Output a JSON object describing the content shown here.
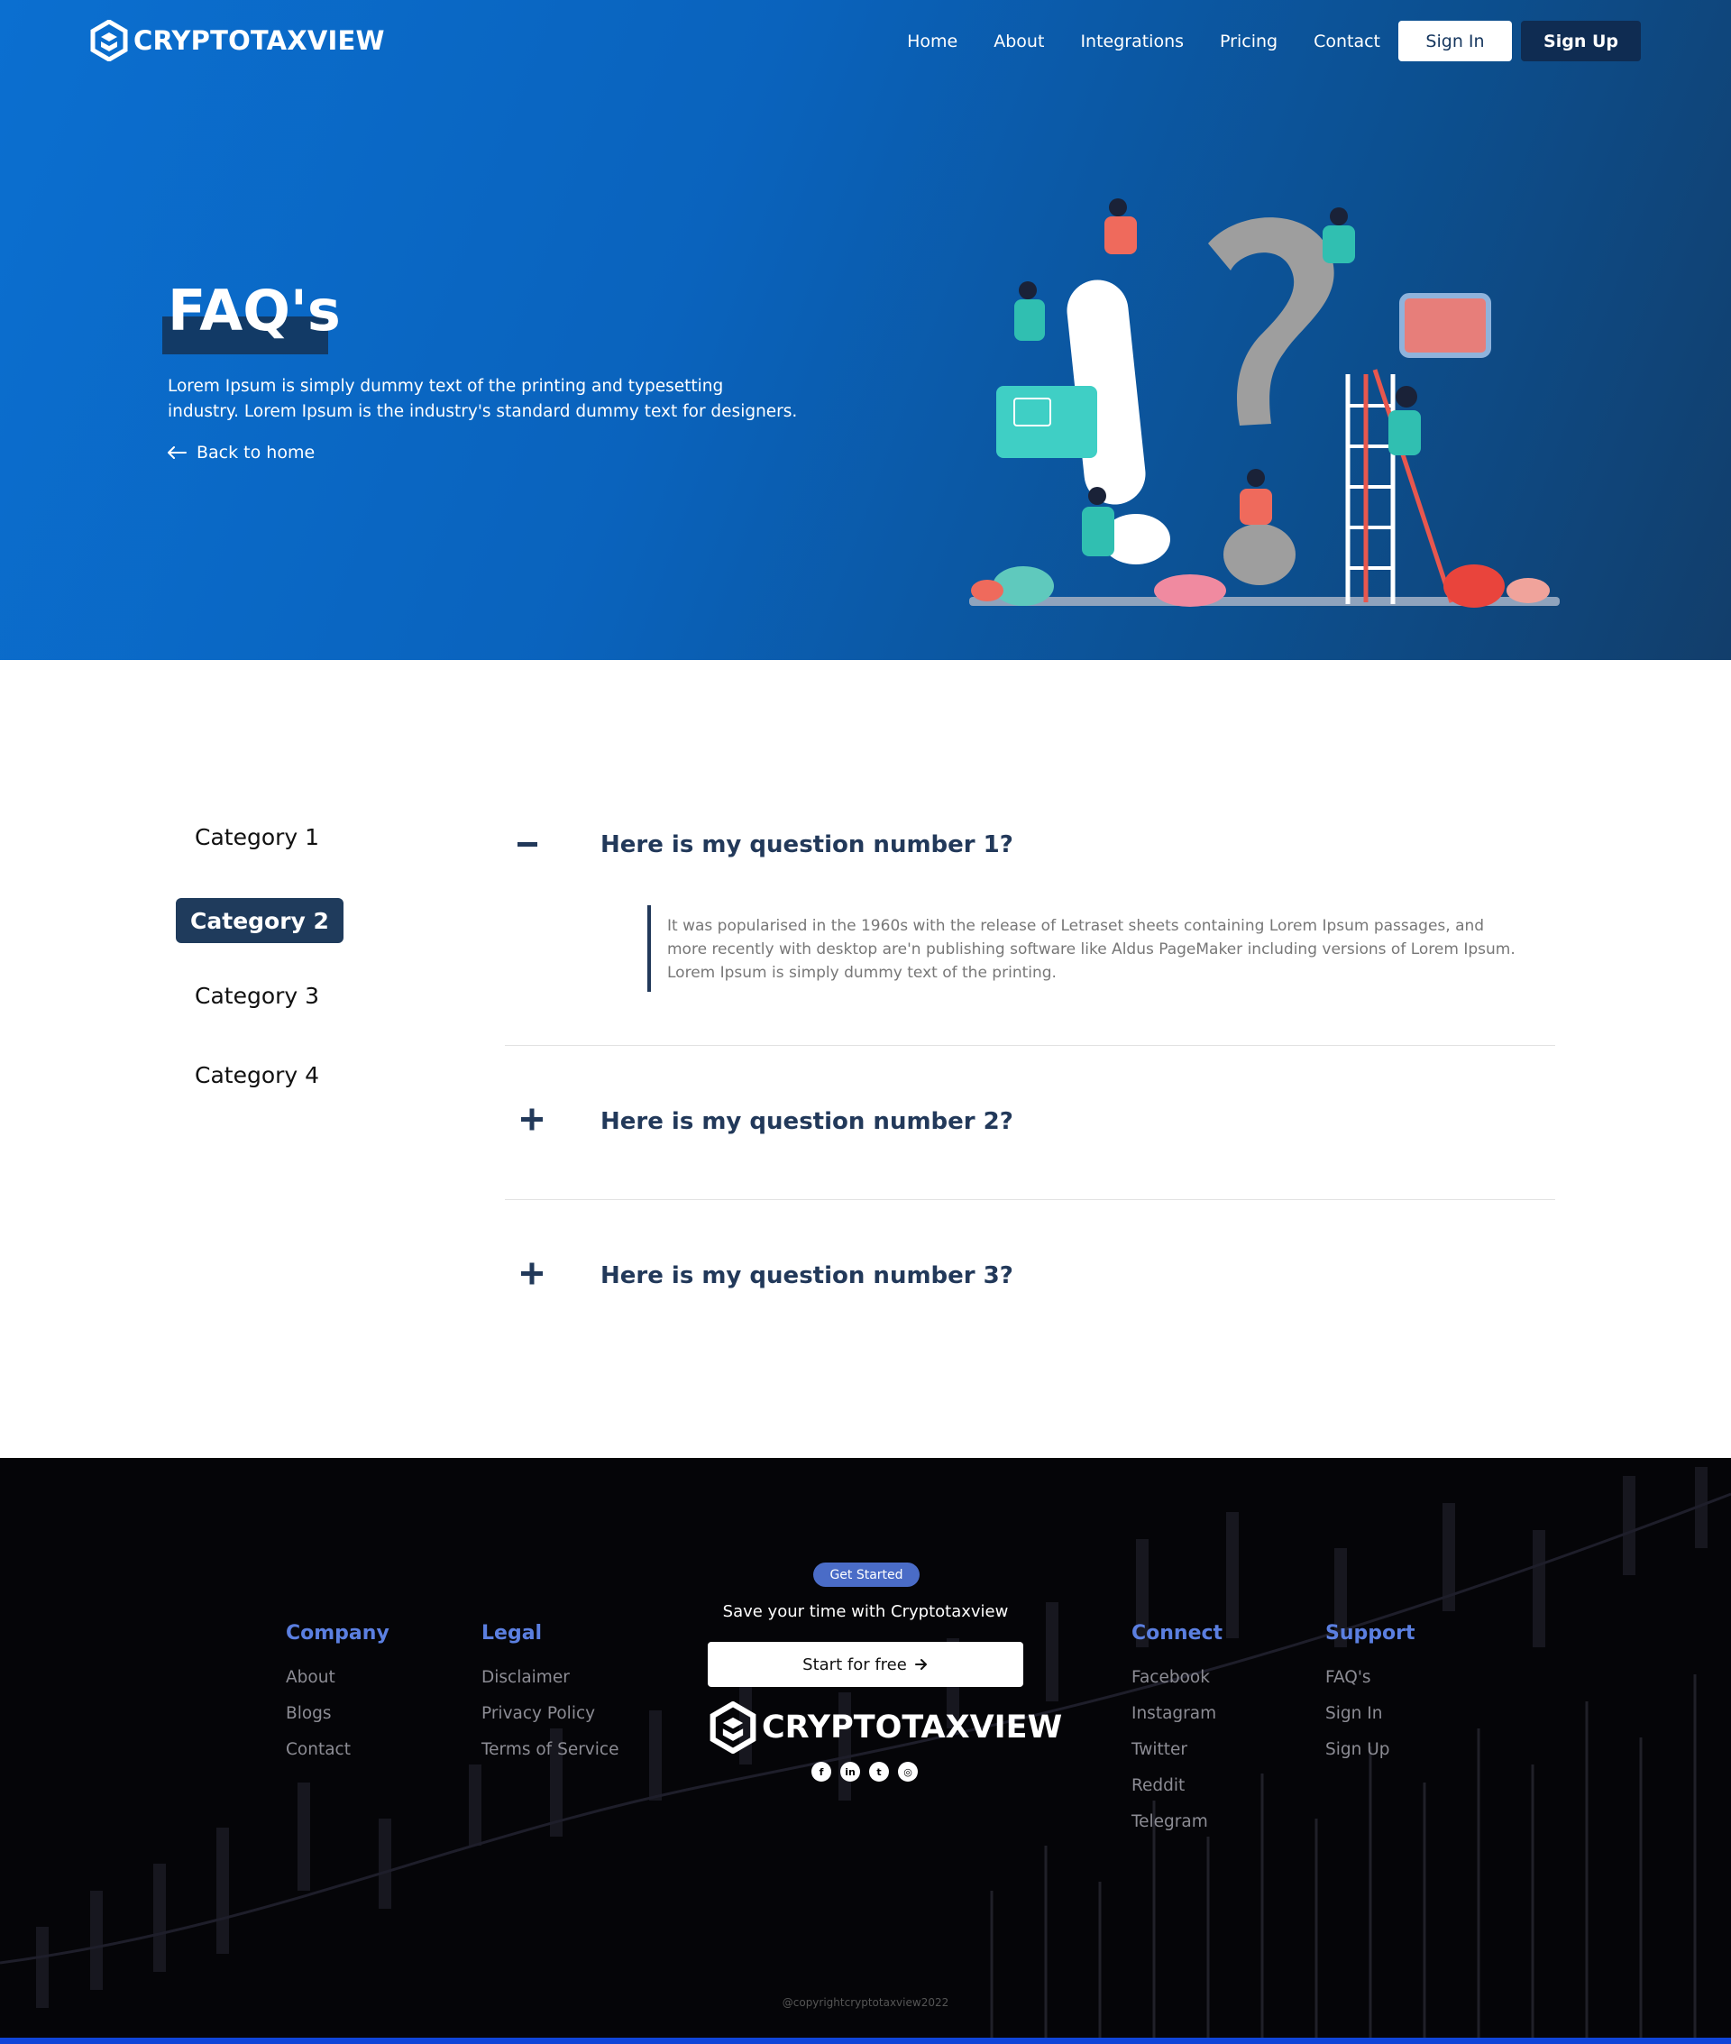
{
  "brand": {
    "name": "CRYPTOTAXVIEW"
  },
  "nav": {
    "links": [
      "Home",
      "About",
      "Integrations",
      "Pricing",
      "Contact"
    ],
    "sign_in": "Sign In",
    "sign_up": "Sign Up"
  },
  "hero": {
    "title": "FAQ's",
    "description": "Lorem Ipsum is simply dummy text of the printing and typesetting industry. Lorem Ipsum is the industry's standard dummy text for designers.",
    "back_link": "Back to home"
  },
  "faq": {
    "categories": [
      "Category 1",
      "Category 2",
      "Category 3",
      "Category 4"
    ],
    "active_category": "Category 2",
    "questions": [
      {
        "title": "Here is my question number 1?",
        "expanded": true,
        "icon": "minus-icon",
        "answer": "It was popularised in the 1960s with the release of Letraset sheets containing Lorem Ipsum passages, and more recently with desktop are'n publishing software like Aldus PageMaker including versions of Lorem Ipsum. Lorem Ipsum is simply dummy text of the printing."
      },
      {
        "title": "Here is my question number 2?",
        "expanded": false,
        "icon": "plus-icon"
      },
      {
        "title": "Here is my question number 3?",
        "expanded": false,
        "icon": "plus-icon"
      }
    ]
  },
  "footer": {
    "company": {
      "heading": "Company",
      "links": [
        "About",
        "Blogs",
        "Contact"
      ]
    },
    "legal": {
      "heading": "Legal",
      "links": [
        "Disclaimer",
        "Privacy Policy",
        "Terms of Service"
      ]
    },
    "connect": {
      "heading": "Connect",
      "links": [
        "Facebook",
        "Instagram",
        "Twitter",
        "Reddit",
        "Telegram"
      ]
    },
    "support": {
      "heading": "Support",
      "links": [
        "FAQ's",
        "Sign In",
        "Sign Up"
      ]
    },
    "badge": "Get Started",
    "tagline": "Save your time with Cryptotaxview",
    "cta": "Start for free",
    "socials": [
      "facebook-icon",
      "linkedin-icon",
      "twitter-icon",
      "instagram-icon"
    ],
    "copyright": "@copyrightcryptotaxview2022"
  },
  "colors": {
    "hero_blue": "#0b6fd0",
    "navy": "#1f3b5c",
    "footer_heading": "#5b7fe0",
    "bottom_bar": "#1045d8"
  }
}
